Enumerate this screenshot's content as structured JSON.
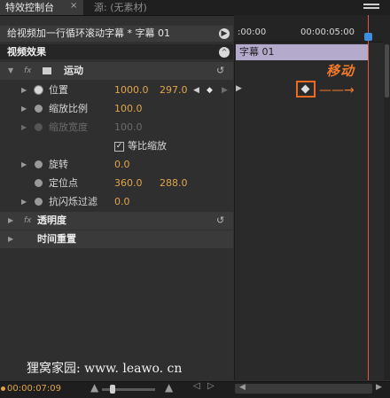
{
  "tabs": [
    {
      "label": "特效控制台",
      "close": "×",
      "active": true
    },
    {
      "label": "源: (无素材)",
      "active": false
    }
  ],
  "sequence": {
    "title": "给视频加一行循环滚动字幕 * 字幕 01",
    "arrow": "▶"
  },
  "section": {
    "label": "视频效果"
  },
  "effects": {
    "motion": {
      "label": "运动",
      "fx": "fx"
    },
    "position": {
      "label": "位置",
      "x": "1000.0",
      "y": "297.0"
    },
    "scale": {
      "label": "缩放比例",
      "value": "100.0"
    },
    "scale_width": {
      "label": "缩放宽度",
      "value": "100.0"
    },
    "uniform_scale": {
      "label": "等比缩放",
      "checked": true
    },
    "rotation": {
      "label": "旋转",
      "value": "0.0"
    },
    "anchor": {
      "label": "定位点",
      "x": "360.0",
      "y": "288.0"
    },
    "antiflicker": {
      "label": "抗闪烁过滤",
      "value": "0.0"
    },
    "opacity": {
      "label": "透明度",
      "fx": "fx"
    },
    "time_remap": {
      "label": "时间重置"
    }
  },
  "timeline": {
    "ruler_start": ":00:00",
    "ruler_end": "00:00:05:00",
    "clip_label": "字幕 01"
  },
  "annotation": {
    "label": "移动",
    "arrow": "——→"
  },
  "watermark": "狸窝家园: www. leawo. cn",
  "footer": {
    "timecode": "00:00:07:09"
  },
  "colors": {
    "accent_value": "#e0a54c",
    "clip": "#b4aacc",
    "annotation": "#f07a2a",
    "playhead": "#e05b3a"
  }
}
